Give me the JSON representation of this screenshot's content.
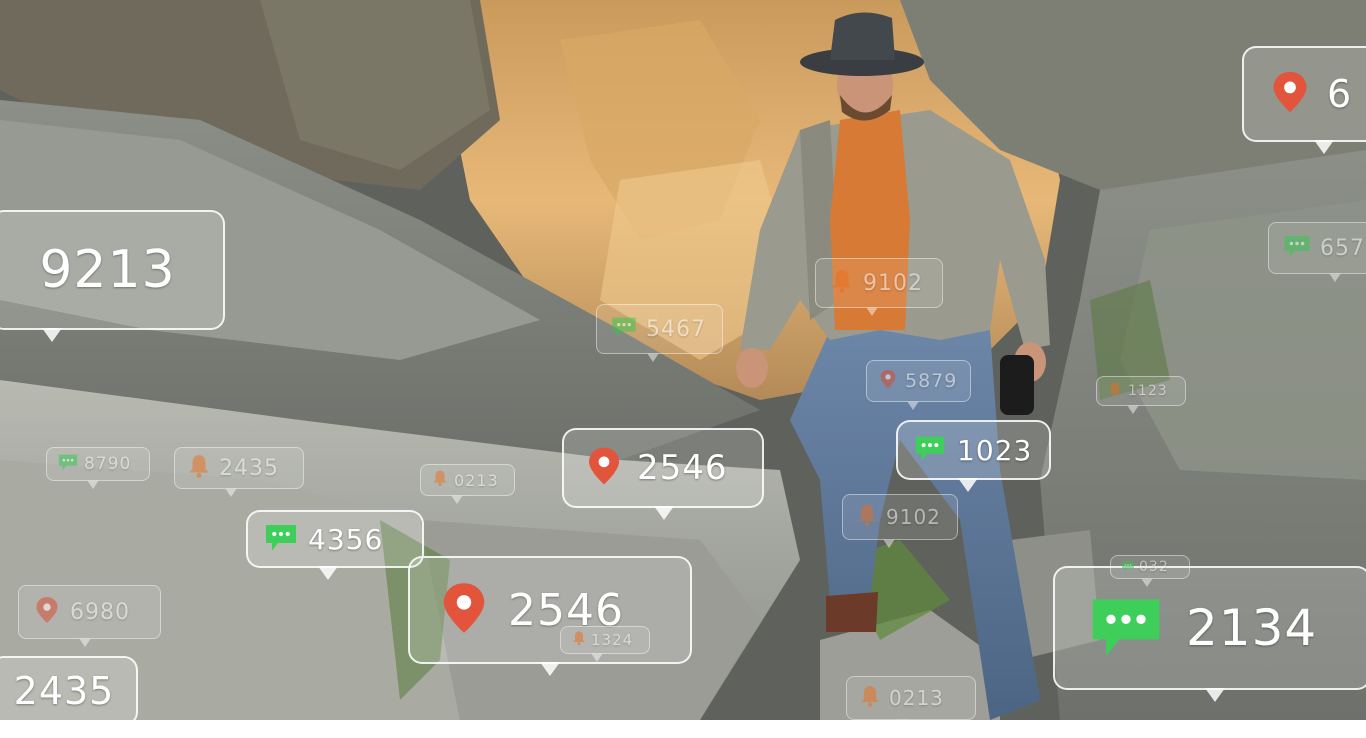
{
  "colors": {
    "pin": "#e2553c",
    "bell": "#ee7a2e",
    "chat": "#3ecf5a",
    "bubble_border": "#ffffff"
  },
  "scene": {
    "subject": "hiker-in-hat",
    "setting": "rocky-cave"
  },
  "notifications": [
    {
      "icon": "none-icon",
      "value": "9213"
    },
    {
      "icon": "pin-icon",
      "value": "6"
    },
    {
      "icon": "chat-icon",
      "value": "657"
    },
    {
      "icon": "bell-icon",
      "value": "9102"
    },
    {
      "icon": "chat-icon",
      "value": "5467"
    },
    {
      "icon": "pin-icon",
      "value": "5879"
    },
    {
      "icon": "chat-icon",
      "value": "1023"
    },
    {
      "icon": "pin-icon",
      "value": "2546"
    },
    {
      "icon": "bell-icon",
      "value": "9102"
    },
    {
      "icon": "chat-icon",
      "value": "8790"
    },
    {
      "icon": "bell-icon",
      "value": "2435"
    },
    {
      "icon": "bell-icon",
      "value": "0213"
    },
    {
      "icon": "chat-icon",
      "value": "4356"
    },
    {
      "icon": "pin-icon",
      "value": "6980"
    },
    {
      "icon": "pin-icon",
      "value": "2546"
    },
    {
      "icon": "bell-icon",
      "value": "1324"
    },
    {
      "icon": "chat-icon",
      "value": "2134"
    },
    {
      "icon": "chat-icon",
      "value": "032"
    },
    {
      "icon": "none-icon",
      "value": "2435"
    },
    {
      "icon": "bell-icon",
      "value": "0213"
    },
    {
      "icon": "bell-icon",
      "value": "1123"
    }
  ]
}
